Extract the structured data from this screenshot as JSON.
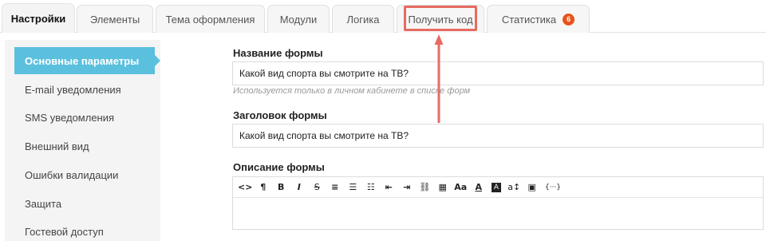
{
  "tabs": [
    {
      "label": "Настройки",
      "active": true
    },
    {
      "label": "Элементы"
    },
    {
      "label": "Тема оформления"
    },
    {
      "label": "Модули"
    },
    {
      "label": "Логика"
    },
    {
      "label": "Получить код",
      "highlighted": true
    },
    {
      "label": "Статистика",
      "badge": "6"
    }
  ],
  "sidebar": {
    "items": [
      {
        "label": "Основные параметры",
        "active": true
      },
      {
        "label": "E-mail уведомления"
      },
      {
        "label": "SMS уведомления"
      },
      {
        "label": "Внешний вид"
      },
      {
        "label": "Ошибки валидации"
      },
      {
        "label": "Защита"
      },
      {
        "label": "Гостевой доступ"
      }
    ]
  },
  "form": {
    "name": {
      "label": "Название формы",
      "value": "Какой вид спорта вы смотрите на ТВ?",
      "help": "Используется только в личном кабинете в списке форм"
    },
    "heading": {
      "label": "Заголовок формы",
      "value": "Какой вид спорта вы смотрите на ТВ?"
    },
    "description": {
      "label": "Описание формы",
      "toolbar": [
        {
          "icon": "code-view-icon",
          "glyph": "<>"
        },
        {
          "icon": "paragraph-icon",
          "glyph": "¶"
        },
        {
          "icon": "bold-icon",
          "glyph": "B"
        },
        {
          "icon": "italic-icon",
          "glyph": "I"
        },
        {
          "icon": "strikethrough-icon",
          "glyph": "S"
        },
        {
          "icon": "align-icon",
          "glyph": "≡"
        },
        {
          "icon": "bullet-list-icon",
          "glyph": "☰"
        },
        {
          "icon": "numbered-list-icon",
          "glyph": "☷"
        },
        {
          "icon": "outdent-icon",
          "glyph": "⇤"
        },
        {
          "icon": "indent-icon",
          "glyph": "⇥"
        },
        {
          "icon": "link-icon",
          "glyph": "⛓"
        },
        {
          "icon": "table-icon",
          "glyph": "▦"
        },
        {
          "icon": "font-size-icon",
          "glyph": "Aa"
        },
        {
          "icon": "text-color-icon",
          "glyph": "A"
        },
        {
          "icon": "background-color-icon",
          "glyph": "A"
        },
        {
          "icon": "line-height-icon",
          "glyph": "a↕"
        },
        {
          "icon": "image-icon",
          "glyph": "▣"
        },
        {
          "icon": "variable-icon",
          "glyph": "{···}"
        }
      ]
    }
  },
  "colors": {
    "accent": "#5bc0de",
    "badge": "#e8531b",
    "annotation": "#e76b61"
  }
}
